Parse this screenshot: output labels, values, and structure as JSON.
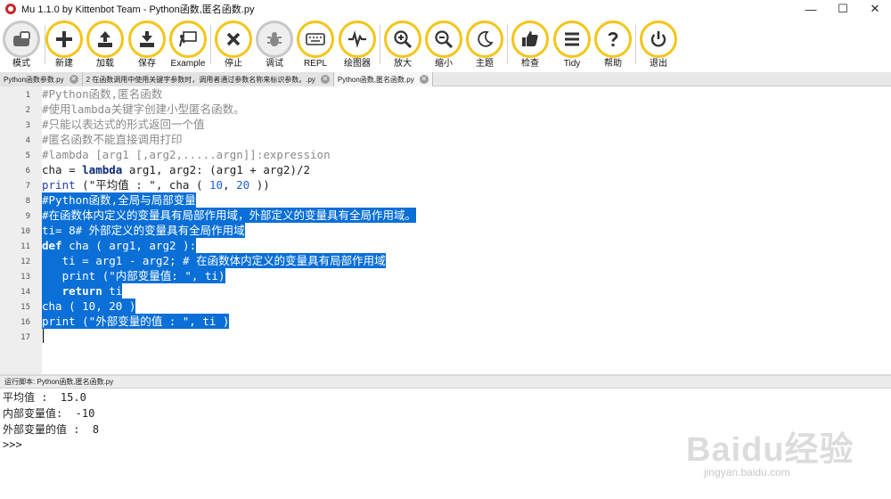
{
  "window": {
    "title": "Mu 1.1.0 by Kittenbot Team - Python函数,匿名函数.py",
    "controls": [
      "—",
      "☐",
      "✕"
    ]
  },
  "toolbar": {
    "buttons": [
      {
        "label": "模式",
        "icon": "mode-icon"
      },
      {
        "label": "新建",
        "icon": "plus-icon"
      },
      {
        "label": "加载",
        "icon": "upload-icon"
      },
      {
        "label": "保存",
        "icon": "download-icon"
      },
      {
        "label": "Example",
        "icon": "presentation-icon"
      },
      {
        "label": "停止",
        "icon": "x-icon"
      },
      {
        "label": "调试",
        "icon": "bug-icon"
      },
      {
        "label": "REPL",
        "icon": "keyboard-icon"
      },
      {
        "label": "绘图器",
        "icon": "pulse-icon"
      },
      {
        "label": "放大",
        "icon": "zoom-in-icon"
      },
      {
        "label": "缩小",
        "icon": "zoom-out-icon"
      },
      {
        "label": "主题",
        "icon": "moon-icon"
      },
      {
        "label": "检查",
        "icon": "thumbs-up-icon"
      },
      {
        "label": "Tidy",
        "icon": "lines-icon"
      },
      {
        "label": "帮助",
        "icon": "question-icon"
      },
      {
        "label": "退出",
        "icon": "power-icon"
      }
    ],
    "accent": "#f5c518"
  },
  "tabs": [
    {
      "label": "Python函数参数.py"
    },
    {
      "label": "2 在函数调用中使用关键字参数时，调用者通过参数名称来标识参数。.py"
    },
    {
      "label": "Python函数,匿名函数.py"
    }
  ],
  "editor": {
    "line_numbers": [
      "1",
      "2",
      "3",
      "4",
      "5",
      "6",
      "7",
      "8",
      "9",
      "10",
      "11",
      "12",
      "13",
      "14",
      "15",
      "16",
      "17"
    ],
    "lines": [
      "#Python函数,匿名函数",
      "#使用lambda关键字创建小型匿名函数。",
      "#只能以表达式的形式返回一个值",
      "#匿名函数不能直接调用打印",
      "#lambda [arg1 [,arg2,.....argn]]:expression",
      "cha = ",
      "lambda",
      " arg1, arg2: (arg1 + arg2)/2",
      "print",
      " (\"平均值 : \", cha ( ",
      "10",
      ", ",
      "20",
      " ))",
      "#Python函数,全局与局部变量",
      "#在函数体内定义的变量具有局部作用域，外部定义的变量具有全局作用域。",
      "ti= 8# 外部定义的变量具有全局作用域",
      "def",
      " cha ( arg1, arg2 ):",
      "   ti = arg1 - arg2; # 在函数体内定义的变量具有局部作用域",
      "   print (\"内部变量值: \", ti)",
      "   ",
      "return",
      " ti",
      "cha ( 10, 20 )",
      "print (\"外部变量的值 : \", ti )"
    ],
    "selection_color": "#0a6fd6"
  },
  "repl": {
    "header": "运行脚本: Python函数,匿名函数.py",
    "output": [
      "平均值 :  15.0",
      "内部变量值:  -10",
      "外部变量的值 :  8",
      ">>>"
    ]
  },
  "watermark": {
    "logo": "Baidu经验",
    "sub": "jingyan.baidu.com"
  }
}
